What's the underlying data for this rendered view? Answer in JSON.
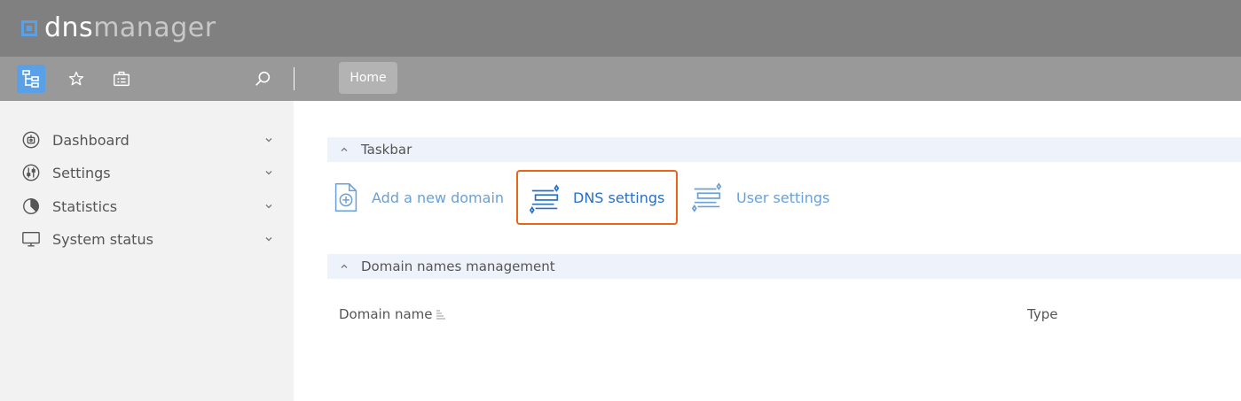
{
  "app": {
    "logo_dns": "dns",
    "logo_manager": "manager",
    "logo_icon": "square-logo-icon"
  },
  "toolbar": {
    "buttons": [
      {
        "icon": "tree-menu-icon",
        "active": true
      },
      {
        "icon": "star-icon",
        "active": false
      },
      {
        "icon": "briefcase-icon",
        "active": false
      }
    ],
    "search_icon": "search-icon",
    "home_tab": "Home"
  },
  "sidebar": {
    "items": [
      {
        "label": "Dashboard",
        "icon": "dashboard-icon"
      },
      {
        "label": "Settings",
        "icon": "settings-sliders-icon"
      },
      {
        "label": "Statistics",
        "icon": "pie-chart-icon"
      },
      {
        "label": "System status",
        "icon": "monitor-icon"
      }
    ]
  },
  "main": {
    "taskbar": {
      "title": "Taskbar",
      "tasks": [
        {
          "label": "Add a new domain",
          "icon": "add-document-icon"
        },
        {
          "label": "DNS settings",
          "icon": "dns-settings-icon",
          "selected": true
        },
        {
          "label": "User settings",
          "icon": "user-settings-icon"
        }
      ]
    },
    "domains": {
      "title": "Domain names management",
      "columns": [
        "Domain name",
        "Type"
      ]
    }
  },
  "colors": {
    "header": "#808080",
    "toolbar": "#999999",
    "accent": "#5aa0e6",
    "selected_border": "#e8661a",
    "link": "#6aa0d8"
  }
}
